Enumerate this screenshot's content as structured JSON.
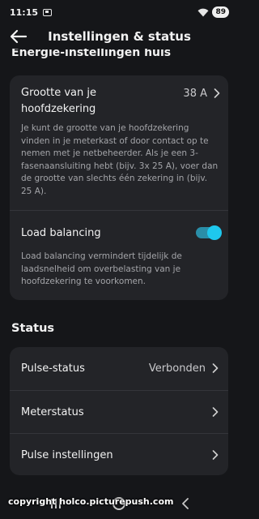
{
  "status_bar": {
    "time": "11:15",
    "battery": "89"
  },
  "header": {
    "title": "Instellingen & status"
  },
  "energy_section": {
    "heading": "Energie-instellingen huis",
    "fuse": {
      "title": "Grootte van je hoofdzekering",
      "value": "38 A",
      "description": "Je kunt de grootte van je hoofdzekering vinden in je meterkast of door contact op te nemen met je netbeheerder. Als je een 3-fasenaansluiting hebt (bijv. 3x 25 A), voer dan de grootte van slechts één zekering in (bijv. 25 A)."
    },
    "load_balancing": {
      "label": "Load balancing",
      "enabled": true,
      "description": "Load balancing vermindert tijdelijk de laadsnelheid om overbelasting van je hoofdzekering te voorkomen."
    }
  },
  "status_section": {
    "heading": "Status",
    "items": [
      {
        "label": "Pulse-status",
        "value": "Verbonden"
      },
      {
        "label": "Meterstatus",
        "value": ""
      },
      {
        "label": "Pulse instellingen",
        "value": ""
      }
    ]
  },
  "watermark": "copyright holco.picturepush.com",
  "colors": {
    "background": "#151619",
    "card": "#232428",
    "accent": "#1ec8ee"
  }
}
